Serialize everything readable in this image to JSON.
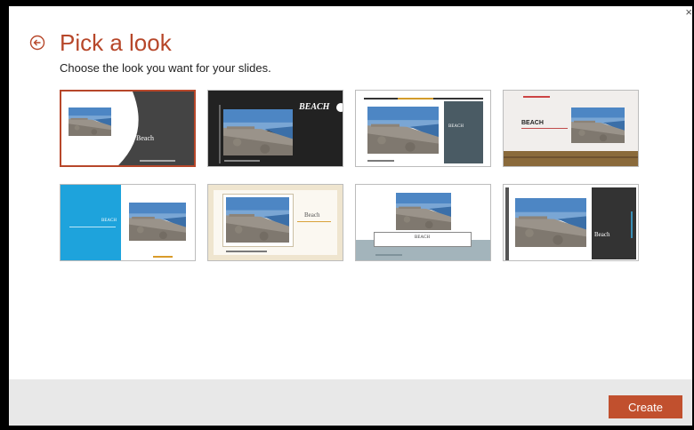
{
  "dialog": {
    "title": "Pick a look",
    "subtitle": "Choose the look you want for your slides.",
    "close_glyph": "×",
    "create_label": "Create"
  },
  "designs": [
    {
      "label": "Beach",
      "selected": true
    },
    {
      "label": "BEACH",
      "selected": false
    },
    {
      "label": "BEACH",
      "selected": false
    },
    {
      "label": "BEACH",
      "selected": false
    },
    {
      "label": "BEACH",
      "selected": false
    },
    {
      "label": "Beach",
      "selected": false
    },
    {
      "label": "BEACH",
      "selected": false
    },
    {
      "label": "Beach",
      "selected": false
    }
  ],
  "colors": {
    "accent": "#b7472a",
    "create_button": "#c1502e",
    "footer": "#e8e8e8"
  },
  "icons": {
    "back": "back-arrow-circle-icon",
    "close": "close-icon"
  }
}
